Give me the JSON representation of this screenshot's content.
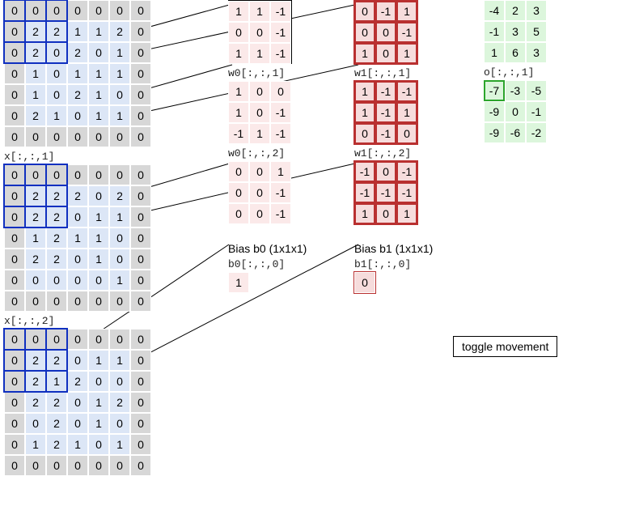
{
  "input": {
    "label0": "x[:,:,1]",
    "label1": "x[:,:,2]",
    "slice0_rows": [
      [
        "0",
        "0",
        "0",
        "0",
        "0",
        "0",
        "0"
      ],
      [
        "0",
        "2",
        "2",
        "1",
        "1",
        "2",
        "0"
      ],
      [
        "0",
        "2",
        "0",
        "2",
        "0",
        "1",
        "0"
      ],
      [
        "0",
        "1",
        "0",
        "1",
        "1",
        "1",
        "0"
      ],
      [
        "0",
        "1",
        "0",
        "2",
        "1",
        "0",
        "0"
      ],
      [
        "0",
        "2",
        "1",
        "0",
        "1",
        "1",
        "0"
      ],
      [
        "0",
        "0",
        "0",
        "0",
        "0",
        "0",
        "0"
      ]
    ],
    "slice1_rows": [
      [
        "0",
        "0",
        "0",
        "0",
        "0",
        "0",
        "0"
      ],
      [
        "0",
        "2",
        "2",
        "2",
        "0",
        "2",
        "0"
      ],
      [
        "0",
        "2",
        "2",
        "0",
        "1",
        "1",
        "0"
      ],
      [
        "0",
        "1",
        "2",
        "1",
        "1",
        "0",
        "0"
      ],
      [
        "0",
        "2",
        "2",
        "0",
        "1",
        "0",
        "0"
      ],
      [
        "0",
        "0",
        "0",
        "0",
        "0",
        "1",
        "0"
      ],
      [
        "0",
        "0",
        "0",
        "0",
        "0",
        "0",
        "0"
      ]
    ],
    "slice2_rows": [
      [
        "0",
        "0",
        "0",
        "0",
        "0",
        "0",
        "0"
      ],
      [
        "0",
        "2",
        "2",
        "0",
        "1",
        "1",
        "0"
      ],
      [
        "0",
        "2",
        "1",
        "2",
        "0",
        "0",
        "0"
      ],
      [
        "0",
        "2",
        "2",
        "0",
        "1",
        "2",
        "0"
      ],
      [
        "0",
        "0",
        "2",
        "0",
        "1",
        "0",
        "0"
      ],
      [
        "0",
        "1",
        "2",
        "1",
        "0",
        "1",
        "0"
      ],
      [
        "0",
        "0",
        "0",
        "0",
        "0",
        "0",
        "0"
      ]
    ]
  },
  "w0": {
    "label1": "w0[:,:,1]",
    "label2": "w0[:,:,2]",
    "slice0": [
      [
        "1",
        "1",
        "-1"
      ],
      [
        "0",
        "0",
        "-1"
      ],
      [
        "1",
        "1",
        "-1"
      ]
    ],
    "slice1": [
      [
        "1",
        "0",
        "0"
      ],
      [
        "1",
        "0",
        "-1"
      ],
      [
        "-1",
        "1",
        "-1"
      ]
    ],
    "slice2": [
      [
        "0",
        "0",
        "1"
      ],
      [
        "0",
        "0",
        "-1"
      ],
      [
        "0",
        "0",
        "-1"
      ]
    ]
  },
  "w1": {
    "label1": "w1[:,:,1]",
    "label2": "w1[:,:,2]",
    "slice0": [
      [
        "0",
        "-1",
        "1"
      ],
      [
        "0",
        "0",
        "-1"
      ],
      [
        "1",
        "0",
        "1"
      ]
    ],
    "slice1": [
      [
        "1",
        "-1",
        "-1"
      ],
      [
        "1",
        "-1",
        "1"
      ],
      [
        "0",
        "-1",
        "0"
      ]
    ],
    "slice2": [
      [
        "-1",
        "0",
        "-1"
      ],
      [
        "-1",
        "-1",
        "-1"
      ],
      [
        "1",
        "0",
        "1"
      ]
    ]
  },
  "bias": {
    "b0_title": "Bias b0 (1x1x1)",
    "b0_label": "b0[:,:,0]",
    "b0_val": "1",
    "b1_title": "Bias b1 (1x1x1)",
    "b1_label": "b1[:,:,0]",
    "b1_val": "0"
  },
  "output": {
    "label1": "o[:,:,1]",
    "slice0": [
      [
        "-4",
        "2",
        "3"
      ],
      [
        "-1",
        "3",
        "5"
      ],
      [
        "1",
        "6",
        "3"
      ]
    ],
    "slice1": [
      [
        "-7",
        "-3",
        "-5"
      ],
      [
        "-9",
        "0",
        "-1"
      ],
      [
        "-9",
        "-6",
        "-2"
      ]
    ]
  },
  "button": "toggle movement",
  "highlight": {
    "input_tl_size": 3
  }
}
